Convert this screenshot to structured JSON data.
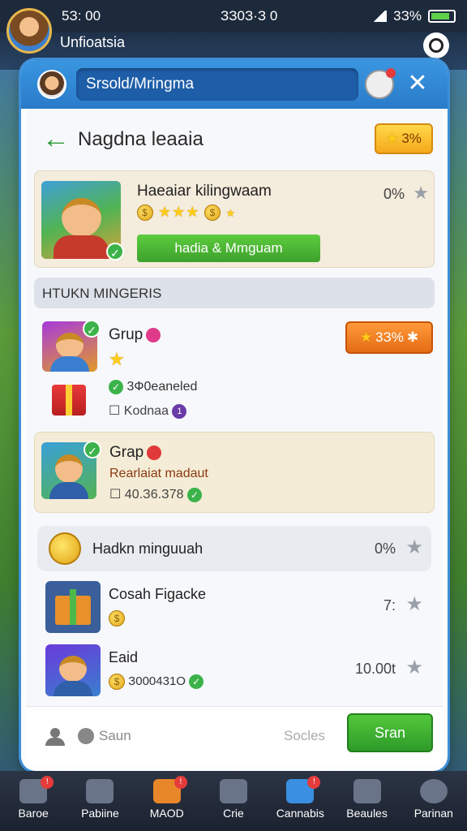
{
  "status": {
    "time": "5З: 00",
    "center": "ЗЗ0З·З 0",
    "battery": "3З%"
  },
  "game": {
    "player_name": "Unfioatsia"
  },
  "modal": {
    "title": "Srsold/Mringma",
    "header_title": "Nagdna leaaia",
    "header_pill": "3%",
    "featured": {
      "title": "Haeaiar kilingwaam",
      "percent": "0%",
      "button": "hadia & Mmguam"
    },
    "section_header": "HTUKN MINGERIS",
    "group1": {
      "title": "Grup",
      "line1": "3Ф0eaneled",
      "line2": "Kodnaa",
      "pill": "3З%"
    },
    "group2": {
      "title": "Grap",
      "line1": "Rearlaiat madaut",
      "line2": "40.З6.З78"
    },
    "coin_row": {
      "title": "Hadkn minguuah",
      "percent": "0%"
    },
    "items": [
      {
        "title": "Cosah Figacke",
        "value": "7:"
      },
      {
        "title": "Eaid",
        "sub": "З000431О",
        "value": "10.00t"
      }
    ],
    "footer": {
      "save": "Saun",
      "socials": "Socles",
      "start": "Sran"
    }
  },
  "nav": [
    {
      "label": "Baroe",
      "badge": "!"
    },
    {
      "label": "Pabiine",
      "badge": ""
    },
    {
      "label": "MAOD",
      "badge": "!"
    },
    {
      "label": "Crie",
      "badge": ""
    },
    {
      "label": "Cannabis",
      "badge": "!"
    },
    {
      "label": "Beaules",
      "badge": ""
    },
    {
      "label": "Parinan",
      "badge": ""
    }
  ]
}
